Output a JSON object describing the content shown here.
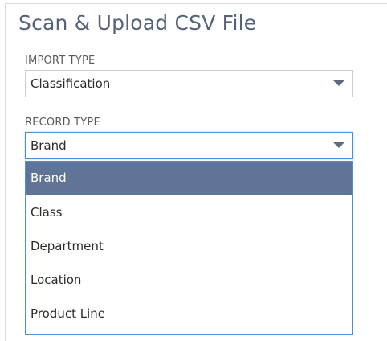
{
  "page": {
    "title": "Scan & Upload CSV File"
  },
  "import_type": {
    "label": "IMPORT TYPE",
    "value": "Classification",
    "caret_icon": "triangle-down-icon"
  },
  "record_type": {
    "label": "RECORD TYPE",
    "value": "Brand",
    "caret_icon": "triangle-down-icon",
    "options": [
      "Brand",
      "Class",
      "Department",
      "Location",
      "Product Line"
    ],
    "selected_index": 0
  },
  "colors": {
    "title": "#56627a",
    "focus_border": "#4d8ed6",
    "selected_option_bg": "#607498",
    "caret": "#5c6a82"
  }
}
